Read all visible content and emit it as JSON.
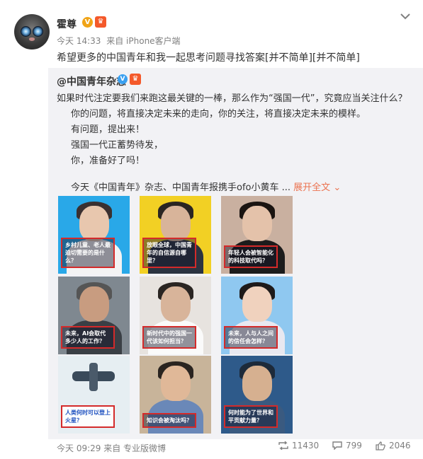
{
  "author": {
    "name": "霍尊",
    "badges": [
      "V"
    ],
    "meta_time": "今天 14:33",
    "meta_source": "来自 iPhone客户端",
    "text": "希望更多的中国青年和我一起思考问题寻找答案[并不简单][并不简单]"
  },
  "repost": {
    "author": "@中国青年杂志",
    "lines": [
      "如果时代注定要我们来跑这最关键的一棒，那么作为“强国一代”，究竟应当关注什么？",
      "你的问题，将直接决定未来的走向，你的关注，将直接决定未来的模样。",
      "有问题，提出来！",
      "强国一代正蓄势待发，",
      "你，准备好了吗！"
    ],
    "summary": "今天《中国青年》杂志、中国青年报携手ofo小黄车 ...",
    "expand_label": "展开全文",
    "images": [
      {
        "caption": "乡村儿童、老人最迫切需要的是什么？",
        "style": "light"
      },
      {
        "caption": "放眼全球，中国青年的自信源自哪里？",
        "style": "light"
      },
      {
        "caption": "年轻人会被智能化的科技取代吗？",
        "style": "light"
      },
      {
        "caption": "未来，AI会取代多少人的工作？",
        "style": "light"
      },
      {
        "caption": "新时代中的强国一代该如何担当？",
        "style": "light"
      },
      {
        "caption": "未来，人与人之间的信任会怎样？",
        "style": "light"
      },
      {
        "caption": "人类何时可以登上火星？",
        "style": "dark"
      },
      {
        "caption": "知识会被淘汰吗？",
        "style": "light"
      },
      {
        "caption": "何时能为了世界和平贡献力量？",
        "style": "light"
      }
    ],
    "time": "今天 09:29",
    "source": "来自 专业版微博",
    "counts": {
      "reposts": "11430",
      "comments": "799",
      "likes": "2046"
    }
  },
  "colors": {
    "accent": "#eb7350",
    "muted": "#808080",
    "repost_bg": "#f2f2f5"
  },
  "icons": [
    "avatar-cat",
    "verified-badge",
    "crown-badge",
    "chevron-down-icon",
    "repost-icon",
    "comment-icon",
    "like-icon"
  ]
}
